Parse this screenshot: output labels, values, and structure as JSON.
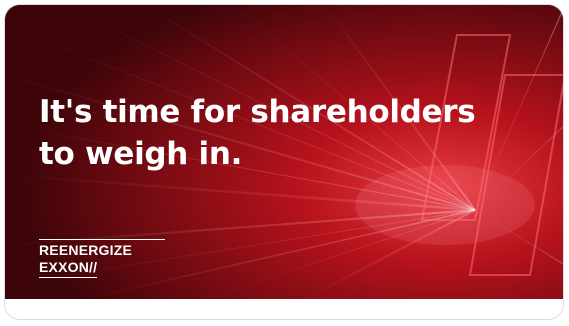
{
  "card": {
    "headline_line1": "It's time for shareholders",
    "headline_line2": "to weigh in.",
    "logo_line1": "REENERGIZE",
    "logo_line2": "EXXON//"
  },
  "colors": {
    "background_dark": "#4a070c",
    "background_red": "#c0141f",
    "highlight": "#ff5a60",
    "text": "#ffffff"
  },
  "icons": {
    "brand": "reenergize-exxon-logo"
  }
}
